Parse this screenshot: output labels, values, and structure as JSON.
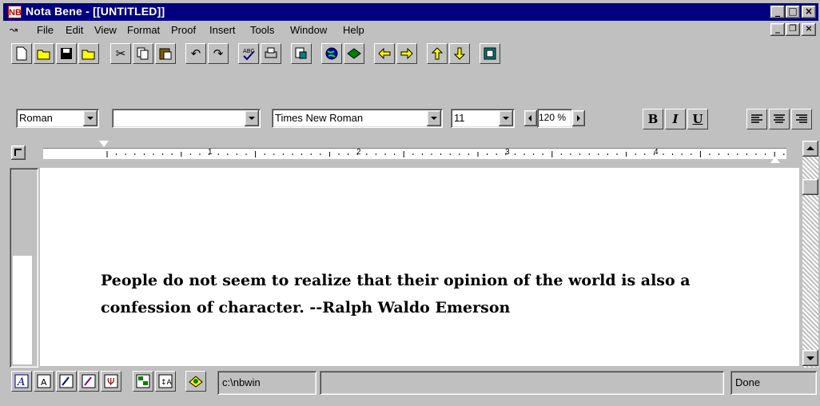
{
  "app": {
    "icon_text": "NB",
    "title": "Nota Bene - [[UNTITLED]]"
  },
  "window_controls": {
    "minimize": "_",
    "maximize": "□",
    "close": "×"
  },
  "menu": {
    "items": [
      {
        "label": "File"
      },
      {
        "label": "Edit"
      },
      {
        "label": "View"
      },
      {
        "label": "Format"
      },
      {
        "label": "Proof"
      },
      {
        "label": "Insert"
      },
      {
        "label": "Tools"
      },
      {
        "label": "Window"
      },
      {
        "label": "Help"
      }
    ],
    "mdi": {
      "minimize": "_",
      "restore": "❐",
      "close": "×"
    }
  },
  "toolbar": {
    "icons": [
      "new-icon",
      "open-icon",
      "save-icon",
      "open-folder-icon",
      "cut-icon",
      "copy-icon",
      "paste-icon",
      "undo-icon",
      "redo-icon",
      "spell-check-icon",
      "print-icon",
      "export-icon",
      "globe-icon",
      "book-icon",
      "arrow-left-icon",
      "arrow-right-icon",
      "arrow-up-icon",
      "arrow-down-icon",
      "window-icon"
    ]
  },
  "format": {
    "style_value": "Roman",
    "style2_value": "",
    "font_value": "Times New Roman",
    "size_value": "11",
    "zoom_value": "120 %",
    "bold": "B",
    "italic": "I",
    "underline": "U"
  },
  "ruler": {
    "numbers": [
      "1",
      "2",
      "3",
      "4"
    ]
  },
  "document": {
    "line1": "People do not seem to realize that their opinion of the world is also a",
    "line2": "confession of character. --Ralph Waldo Emerson"
  },
  "status": {
    "path": "c:\\nbwin",
    "message": "",
    "state": "Done"
  },
  "colors": {
    "title_bar": "#000080",
    "chrome": "#c0c0c0"
  }
}
